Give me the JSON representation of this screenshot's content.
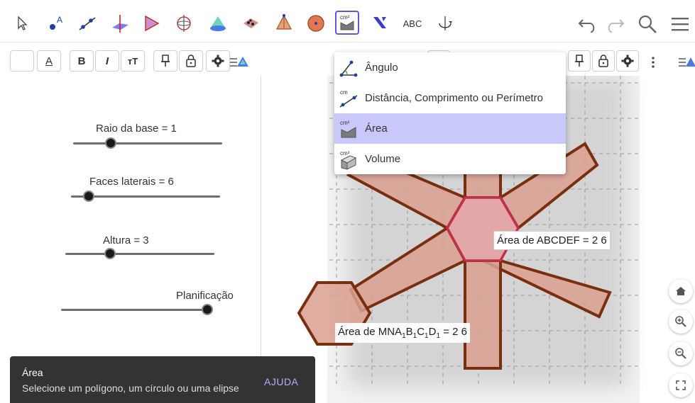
{
  "toolbar": {
    "tools": [
      {
        "name": "move-tool-icon"
      },
      {
        "name": "point-tool-icon",
        "glyph": "A"
      },
      {
        "name": "line-tool-icon"
      },
      {
        "name": "plane-tool-icon"
      },
      {
        "name": "pyramid-tool-icon"
      },
      {
        "name": "rotate-tool-icon"
      },
      {
        "name": "cone-tool-icon"
      },
      {
        "name": "net-tool-icon"
      },
      {
        "name": "prism-tool-icon"
      },
      {
        "name": "sphere-tool-icon"
      },
      {
        "name": "measure-area-tool-icon",
        "glyph": "cm²"
      },
      {
        "name": "transform-tool-icon"
      },
      {
        "name": "text-tool-icon",
        "glyph": "ABC"
      },
      {
        "name": "rotate-view-tool-icon"
      }
    ]
  },
  "stylebar_left": {
    "bold": "B",
    "italic": "I",
    "text_size": "тT",
    "text_color": "A"
  },
  "sliders": [
    {
      "label": "Raio da base = 1",
      "value": 0.25
    },
    {
      "label": "Faces laterais = 6",
      "value": 0.12
    },
    {
      "label": "Altura = 3",
      "value": 0.3
    },
    {
      "label": "Planificação",
      "value": 1.0
    }
  ],
  "dropdown": {
    "items": [
      {
        "label": "Ângulo",
        "icon": "angle-icon",
        "selected": false
      },
      {
        "label": "Distância, Comprimento ou Perímetro",
        "icon": "distance-icon",
        "selected": false,
        "badge": "cm"
      },
      {
        "label": "Área",
        "icon": "area-icon",
        "selected": true,
        "badge": "cm²"
      },
      {
        "label": "Volume",
        "icon": "volume-icon",
        "selected": false,
        "badge": "cm³"
      }
    ]
  },
  "graphics": {
    "label_abcdef": {
      "prefix": "Área de",
      "name": "ABCDEF",
      "value": "= 2 6"
    },
    "label_mna": {
      "prefix": "Área de",
      "name": "MNA",
      "subs": [
        "B",
        "C",
        "D"
      ],
      "value": "= 2 6"
    }
  },
  "toast": {
    "title": "Área",
    "message": "Selecione um polígono, um círculo ou uma elipse",
    "help": "AJUDA"
  },
  "colors": {
    "accent": "#6557d2",
    "net_fill": "#d9a090",
    "net_stroke": "#7a2e0e",
    "hexagon_stroke": "#c0304a",
    "toast_bg": "#333333",
    "selected_bg": "#c8c8fa"
  }
}
